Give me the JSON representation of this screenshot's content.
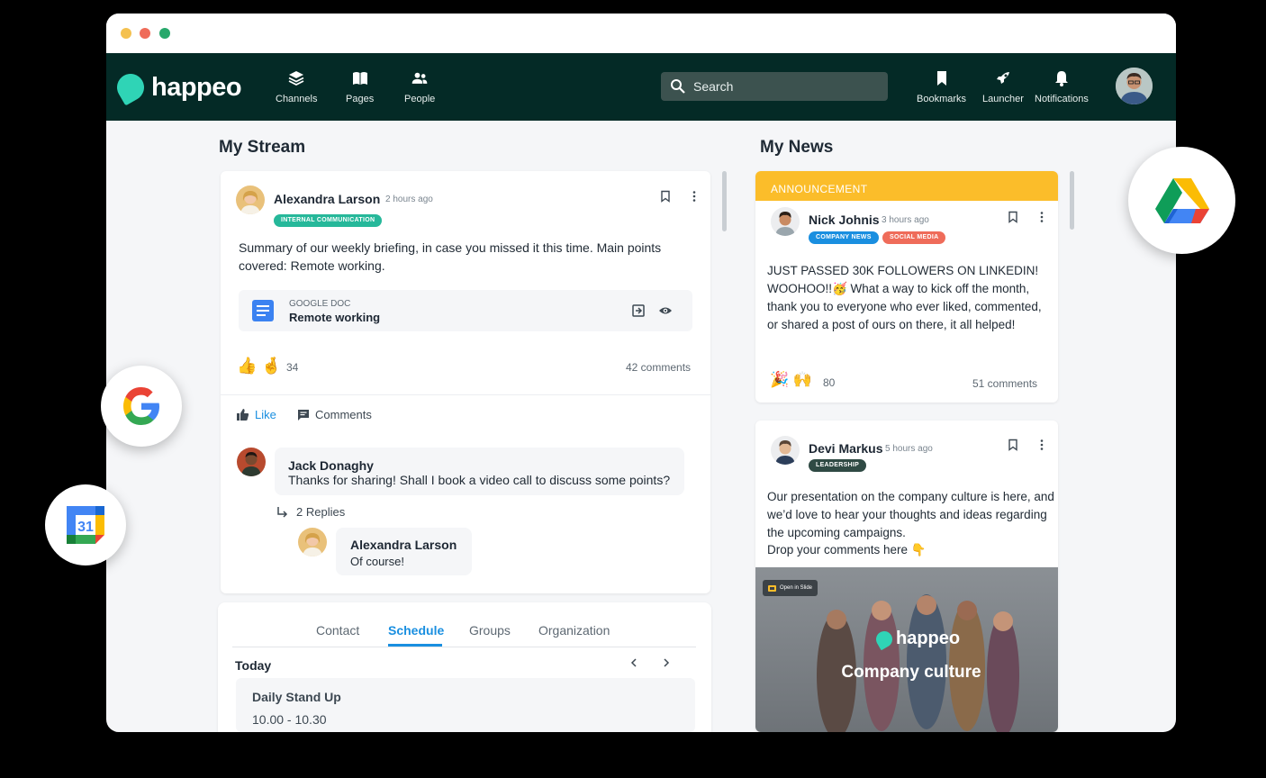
{
  "app": {
    "name": "happeo"
  },
  "nav": {
    "items": [
      {
        "label": "Channels",
        "icon": "layers-icon"
      },
      {
        "label": "Pages",
        "icon": "book-icon"
      },
      {
        "label": "People",
        "icon": "people-icon"
      }
    ],
    "right_items": [
      {
        "label": "Bookmarks",
        "icon": "bookmark-icon"
      },
      {
        "label": "Launcher",
        "icon": "rocket-icon"
      },
      {
        "label": "Notifications",
        "icon": "bell-icon"
      }
    ]
  },
  "search": {
    "placeholder": "Search"
  },
  "stream": {
    "title": "My Stream",
    "post": {
      "author": "Alexandra Larson",
      "time": "2 hours ago",
      "tag": "INTERNAL COMMUNICATION",
      "text": "Summary of our weekly briefing, in case you missed it this time. Main points covered: Remote working.",
      "attachment": {
        "type": "GOOGLE DOC",
        "title": "Remote working"
      },
      "reactions": {
        "emojis": "👍 🤞",
        "count": "34"
      },
      "comments_count": "42 comments",
      "like_label": "Like",
      "comments_label": "Comments",
      "comment": {
        "author": "Jack Donaghy",
        "text": "Thanks for sharing! Shall I book a video call to discuss some points?"
      },
      "replies_label": "2 Replies",
      "reply": {
        "author": "Alexandra Larson",
        "text": "Of course!"
      }
    },
    "widget": {
      "tabs": [
        "Contact",
        "Schedule",
        "Groups",
        "Organization"
      ],
      "active_tab": "Schedule",
      "day": "Today",
      "event": {
        "title": "Daily Stand Up",
        "time": "10.00 - 10.30"
      }
    }
  },
  "news": {
    "title": "My News",
    "announcement": {
      "banner": "ANNOUNCEMENT",
      "author": "Nick Johnis",
      "time": "3 hours ago",
      "tags": [
        "COMPANY NEWS",
        "SOCIAL MEDIA"
      ],
      "text": "JUST PASSED 30K FOLLOWERS ON LINKEDIN! WOOHOO!!🥳 What a way to kick off the month, thank you to everyone who ever liked, commented, or shared a post of ours on there, it all helped!",
      "reactions": {
        "emojis": "🎉 🙌",
        "count": "80"
      },
      "comments_count": "51 comments"
    },
    "post2": {
      "author": "Devi Markus",
      "time": "5 hours ago",
      "tag": "LEADERSHIP",
      "text": "Our presentation on the company culture is here, and we’d love to hear your thoughts and ideas regarding the upcoming campaigns.",
      "text2": "Drop your comments here 👇",
      "media_badge": "Open in Slide",
      "media_logo": "happeo",
      "media_title": "Company culture"
    }
  },
  "colors": {
    "nav_bg": "#042a26",
    "accent": "#1a8fe0",
    "teal_tag": "#26b89a",
    "announcement": "#fbbd2a",
    "social_tag": "#ef6c5a",
    "company_tag": "#1a8fe0",
    "leadership_tag": "#2f4a44"
  }
}
